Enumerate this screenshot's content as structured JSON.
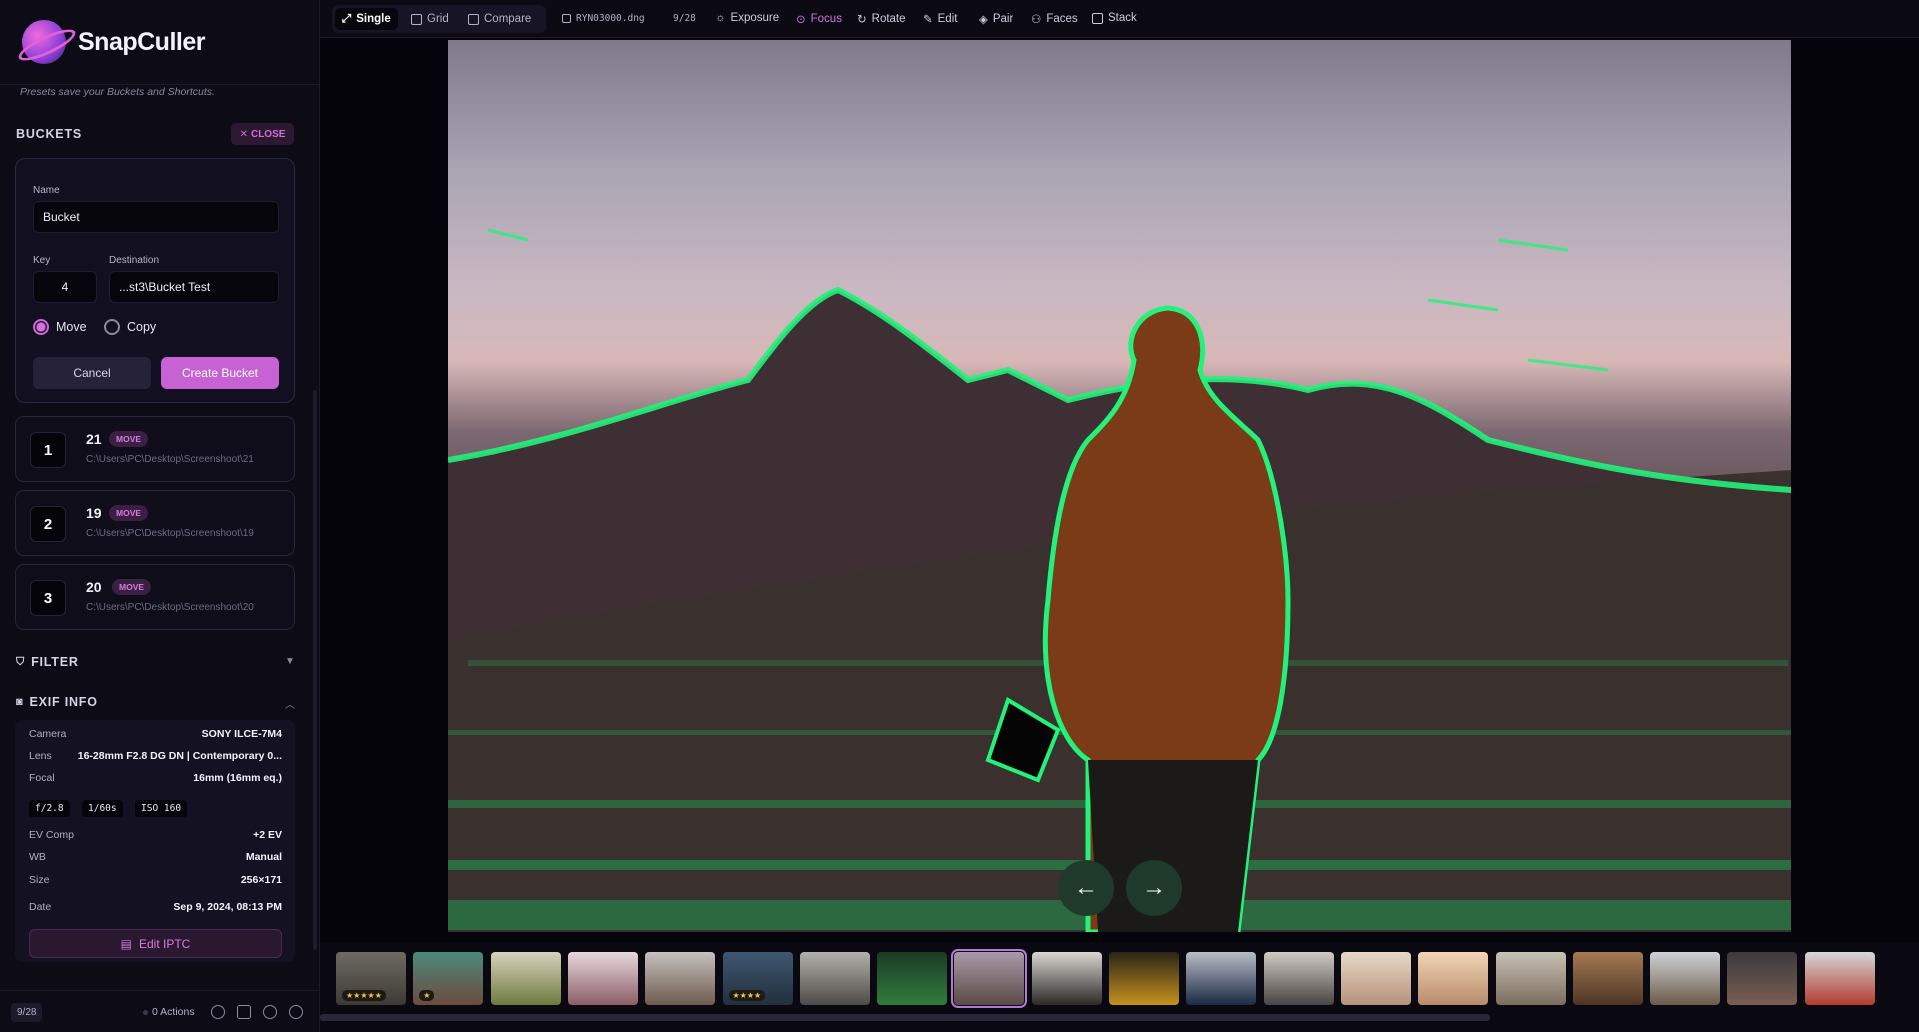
{
  "app": {
    "name": "SnapCuller",
    "presets_hint": "Presets save your Buckets and Shortcuts."
  },
  "buckets": {
    "title": "BUCKETS",
    "close_label": "CLOSE",
    "form": {
      "name_label": "Name",
      "name_value": "Bucket",
      "key_label": "Key",
      "key_value": "4",
      "destination_label": "Destination",
      "destination_value": "...st3\\Bucket Test",
      "move_label": "Move",
      "copy_label": "Copy",
      "cancel_label": "Cancel",
      "create_label": "Create Bucket"
    },
    "items": [
      {
        "key": "1",
        "name": "21",
        "badge": "MOVE",
        "path": "C:\\Users\\PC\\Desktop\\Screenshoot\\21"
      },
      {
        "key": "2",
        "name": "19",
        "badge": "MOVE",
        "path": "C:\\Users\\PC\\Desktop\\Screenshoot\\19"
      },
      {
        "key": "3",
        "name": "20",
        "badge": "MOVE",
        "path": "C:\\Users\\PC\\Desktop\\Screenshoot\\20"
      }
    ]
  },
  "filter": {
    "title": "FILTER"
  },
  "exif": {
    "title": "EXIF INFO",
    "camera_label": "Camera",
    "camera": "SONY ILCE-7M4",
    "lens_label": "Lens",
    "lens": "16-28mm F2.8 DG DN | Contemporary 0...",
    "focal_label": "Focal",
    "focal": "16mm (16mm eq.)",
    "aperture": "f/2.8",
    "shutter": "1/60s",
    "iso": "ISO 160",
    "ev_label": "EV Comp",
    "ev": "+2 EV",
    "wb_label": "WB",
    "wb": "Manual",
    "size_label": "Size",
    "size": "256×171",
    "date_label": "Date",
    "date": "Sep 9, 2024, 08:13 PM",
    "edit_iptc_label": "Edit IPTC"
  },
  "footer": {
    "count": "9/28",
    "actions": "0 Actions"
  },
  "toolbar": {
    "single": "Single",
    "grid": "Grid",
    "compare": "Compare",
    "filename": "RYN03000.dng",
    "position": "9/28",
    "exposure": "Exposure",
    "focus": "Focus",
    "rotate": "Rotate",
    "edit": "Edit",
    "pair": "Pair",
    "faces": "Faces",
    "stack": "Stack"
  },
  "colors": {
    "accent": "#c762d4",
    "focus_peaking": "#22f27a",
    "background": "#07060d"
  },
  "filmstrip": {
    "thumbnails": [
      {
        "rating": "★★★★★"
      },
      {
        "rating": "★"
      },
      {
        "rating": ""
      },
      {
        "rating": ""
      },
      {
        "rating": ""
      },
      {
        "rating": "★★★★"
      },
      {
        "rating": ""
      },
      {
        "rating": ""
      },
      {
        "rating": "",
        "selected": true
      },
      {
        "rating": ""
      },
      {
        "rating": ""
      },
      {
        "rating": ""
      },
      {
        "rating": ""
      },
      {
        "rating": ""
      },
      {
        "rating": ""
      },
      {
        "rating": ""
      },
      {
        "rating": ""
      },
      {
        "rating": ""
      },
      {
        "rating": ""
      },
      {
        "rating": ""
      }
    ]
  }
}
